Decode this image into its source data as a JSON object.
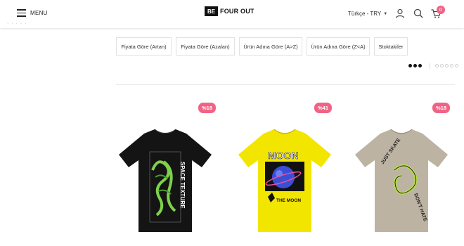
{
  "header": {
    "menu_label": "MENU",
    "logo_mark": "BE",
    "logo_text": "FOUR OUT",
    "language_currency": "Türkçe - TRY",
    "cart_count": "0",
    "breadcrumb_dots": "·  ·  ·  ·  ·"
  },
  "sort_options": [
    {
      "label": "Fiyata Göre (Artan)"
    },
    {
      "label": "Fiyata Göre (Azalan)"
    },
    {
      "label": "Ürün Adına Göre (A>Z)"
    },
    {
      "label": "Ürün Adına Göre (Z<A)"
    },
    {
      "label": "Stoktakiler"
    }
  ],
  "products": [
    {
      "discount": "%18",
      "shirt_color": "#141414",
      "print_text_1": "SPACE TEXTURE",
      "print_text_2": "",
      "accent": "#7fd14a"
    },
    {
      "discount": "%41",
      "shirt_color": "#f2e500",
      "print_text_1": "MOON",
      "print_text_2": "THE MOON",
      "accent": "#3a4fd6"
    },
    {
      "discount": "%18",
      "shirt_color": "#bdb3a2",
      "print_text_1": "JUST SKATE",
      "print_text_2": "DON'T HATE",
      "accent": "#b8e04a"
    }
  ],
  "colors": {
    "badge": "#f06385",
    "icons": "#333333"
  }
}
